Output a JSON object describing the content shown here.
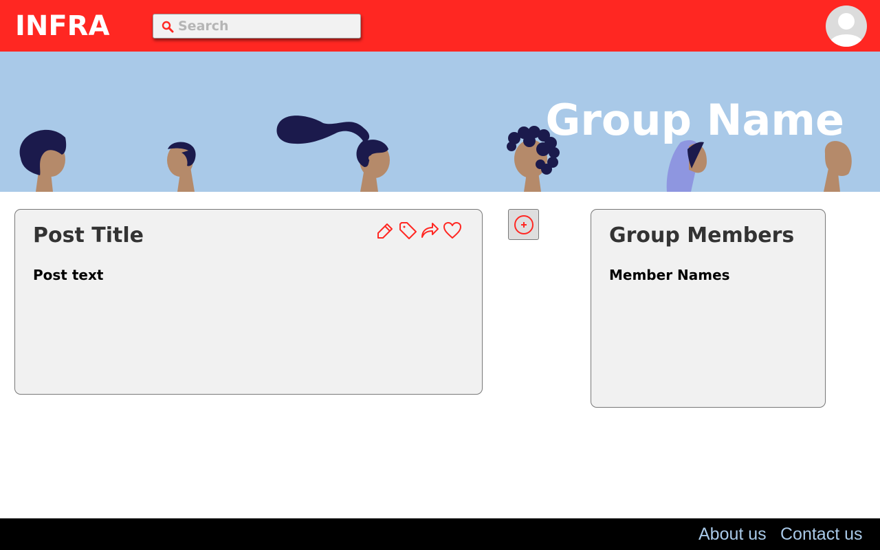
{
  "header": {
    "logo": "INFRA",
    "search_placeholder": "Search",
    "search_value": ""
  },
  "banner": {
    "group_name": "Group Name"
  },
  "post": {
    "title": "Post Title",
    "text": "Post text",
    "actions": [
      "edit-icon",
      "tag-icon",
      "share-icon",
      "heart-icon"
    ]
  },
  "members": {
    "title": "Group Members",
    "text": "Member Names"
  },
  "add_button": {
    "icon": "plus-circle-icon"
  },
  "footer": {
    "about": "About us",
    "contact": "Contact us"
  },
  "colors": {
    "header": "#ff2722",
    "banner": "#a9c9e8",
    "card": "#f1f1f1",
    "footer": "#000000",
    "footer_link": "#a9c9e8",
    "accent": "#ff2722"
  }
}
